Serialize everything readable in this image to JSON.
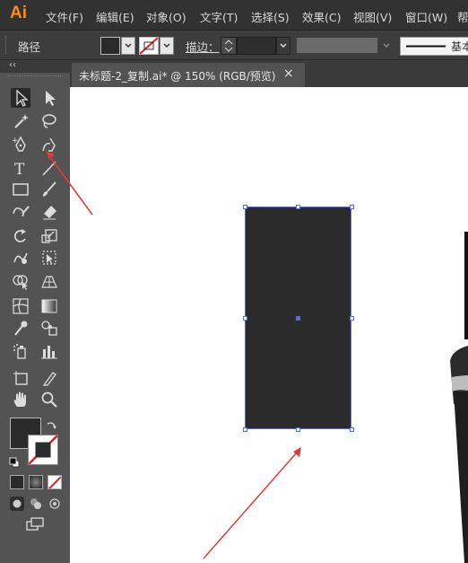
{
  "app": {
    "logo": "Ai"
  },
  "menu": [
    "文件(F)",
    "编辑(E)",
    "对象(O)",
    "文字(T)",
    "选择(S)",
    "效果(C)",
    "视图(V)",
    "窗口(W)",
    "帮"
  ],
  "control_bar": {
    "selection_label": "路径",
    "stroke_label": "描边：",
    "style_label": "基本"
  },
  "document_tab": {
    "title": "未标题-2_复制.ai* @ 150% (RGB/预览)",
    "close": "×"
  },
  "colors": {
    "accent": "#ff8a17",
    "selection": "#4d6cf0",
    "object_fill": "#2b2b2b",
    "annotation": "#e53935"
  },
  "toolbox": {
    "collapse": "‹‹",
    "tools": [
      "selection-tool",
      "direct-selection-tool",
      "magic-wand-tool",
      "lasso-tool",
      "pen-tool",
      "curvature-tool",
      "type-tool",
      "line-segment-tool",
      "rectangle-tool",
      "paintbrush-tool",
      "shaper-tool",
      "eraser-tool",
      "rotate-tool",
      "scale-tool",
      "warp-tool",
      "free-transform-tool",
      "shape-builder-tool",
      "perspective-grid-tool",
      "mesh-tool",
      "gradient-tool",
      "eyedropper-tool",
      "blend-tool",
      "symbol-sprayer-tool",
      "column-graph-tool",
      "artboard-tool",
      "slice-tool",
      "hand-tool",
      "zoom-tool"
    ]
  }
}
